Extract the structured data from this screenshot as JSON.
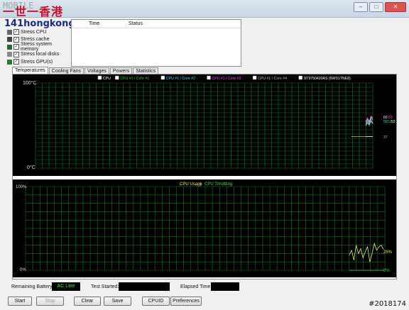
{
  "window": {
    "logo_text": "一世一香港",
    "logo_ghost": "MOBILE",
    "watermark": "141hongkong.com",
    "tag": "#2018174"
  },
  "options": [
    {
      "label": "Stress CPU",
      "checked": true
    },
    {
      "label": "Stress cache",
      "checked": true
    },
    {
      "label": "Stress system memory",
      "checked": true
    },
    {
      "label": "Stress local disks",
      "checked": true
    },
    {
      "label": "Stress GPU(s)",
      "checked": true
    }
  ],
  "log": {
    "col_time": "Time",
    "col_status": "Status"
  },
  "tabs": [
    {
      "label": "Temperatures",
      "active": true
    },
    {
      "label": "Cooling Fans",
      "active": false
    },
    {
      "label": "Voltages",
      "active": false
    },
    {
      "label": "Powers",
      "active": false
    },
    {
      "label": "Statistics",
      "active": false
    }
  ],
  "temp_chart": {
    "legend": [
      {
        "label": "CPU",
        "color": "#ffffff"
      },
      {
        "label": "CPU #1 / Core #1",
        "color": "#33cc33"
      },
      {
        "label": "CPU #1 / Core #2",
        "color": "#44ddff"
      },
      {
        "label": "CPU #1 / Core #3",
        "color": "#ff44ff"
      },
      {
        "label": "CPU #1 / Core #4",
        "color": "#bbbbbb"
      },
      {
        "label": "ST9750420AS (6WS1TNE8)",
        "color": "#ffffff"
      }
    ],
    "y_max_label": "100°C",
    "y_min_label": "0°C",
    "readouts": [
      "60",
      "60",
      "50",
      "52",
      "53",
      "37"
    ]
  },
  "cpu_chart": {
    "legend_usage": "CPU Usage",
    "legend_sep": "|",
    "legend_throttle": "CPU Throttling",
    "y_max_label": "100%",
    "y_min_label": "0%",
    "usage_readout": "25%",
    "throttle_readout": "0%"
  },
  "chart_data": [
    {
      "type": "line",
      "title": "",
      "ylim": [
        0,
        100
      ],
      "series": [
        {
          "name": "CPU",
          "values": [
            55,
            58,
            54,
            60,
            57
          ]
        },
        {
          "name": "CPU #1 / Core #1",
          "values": [
            52,
            56,
            50,
            58,
            60
          ]
        },
        {
          "name": "CPU #1 / Core #2",
          "values": [
            50,
            55,
            52,
            57,
            53
          ]
        },
        {
          "name": "CPU #1 / Core #3",
          "values": [
            53,
            59,
            55,
            61,
            60
          ]
        },
        {
          "name": "CPU #1 / Core #4",
          "values": [
            50,
            53,
            51,
            55,
            52
          ]
        },
        {
          "name": "ST9750420AS (6WS1TNE8)",
          "values": [
            37,
            37,
            37,
            37,
            37
          ]
        }
      ]
    },
    {
      "type": "line",
      "ylim": [
        0,
        100
      ],
      "series": [
        {
          "name": "CPU Usage",
          "values": [
            18,
            24,
            12,
            30,
            20,
            26,
            15,
            22,
            28,
            10,
            20,
            32,
            24,
            28,
            30,
            25
          ]
        },
        {
          "name": "CPU Throttling",
          "values": [
            0,
            0,
            0,
            0,
            0,
            0,
            0,
            0,
            0,
            0,
            0,
            0,
            0,
            0,
            0,
            0
          ]
        }
      ]
    }
  ],
  "status": {
    "battery_label": "Remaining Battery:",
    "battery_value": "AC Line",
    "started_label": "Test Started:",
    "started_value": "",
    "elapsed_label": "Elapsed Time:",
    "elapsed_value": ""
  },
  "buttons": {
    "start": "Start",
    "stop": "Stop",
    "clear": "Clear",
    "save": "Save",
    "cpuid": "CPUID",
    "preferences": "Preferences"
  }
}
